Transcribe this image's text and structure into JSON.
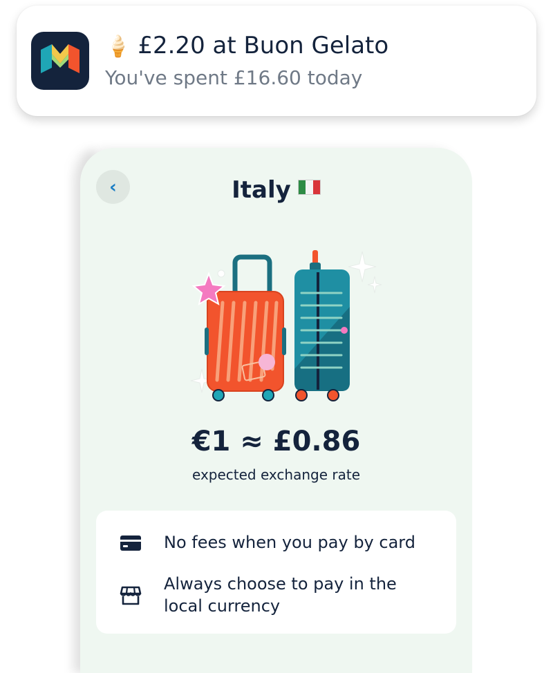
{
  "notification": {
    "app_icon": "monzo-logo",
    "emoji": "🍦",
    "title": "£2.20 at Buon Gelato",
    "subtitle": "You've spent £16.60 today"
  },
  "screen": {
    "back_icon": "chevron-left-icon",
    "title": "Italy",
    "flag": "italy-flag",
    "illustration": "suitcases-illustration",
    "exchange_rate": "€1 ≈ £0.86",
    "exchange_caption": "expected exchange rate",
    "tips": [
      {
        "icon": "card-icon",
        "text": "No fees when you pay by card"
      },
      {
        "icon": "store-icon",
        "text": "Always choose to pay in the local currency"
      }
    ]
  },
  "colors": {
    "navy": "#14233c",
    "screen_bg": "#eff7f1",
    "accent_blue": "#1b7dc4",
    "suitcase_red": "#f2542d",
    "suitcase_teal": "#1f8fa3"
  }
}
